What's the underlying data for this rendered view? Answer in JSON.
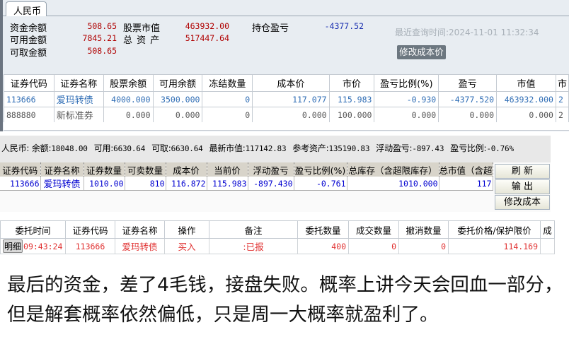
{
  "panel1": {
    "tab": "人民币",
    "summary": [
      {
        "label": "资金余额",
        "value": "508.65"
      },
      {
        "label": "可用金额",
        "value": "7845.21"
      },
      {
        "label": "可取金额",
        "value": "508.65"
      },
      {
        "label": "股票市值",
        "value": "463932.00"
      },
      {
        "label": "总 资 产",
        "value": "517447.64"
      },
      {
        "label": "持仓盈亏",
        "value": "-4377.52"
      }
    ],
    "query_time": "最近查询时间:2024-11-01 11:32:34",
    "modify_cost_button": "修改成本价",
    "columns": [
      "证券代码",
      "证券名称",
      "股票余额",
      "可用余额",
      "冻结数量",
      "成本价",
      "市价",
      "盈亏比例(%)",
      "盈亏",
      "市值",
      "市"
    ],
    "rows": [
      [
        "113666",
        "爱玛转债",
        "4000.000",
        "3500.000",
        "0",
        "117.077",
        "115.983",
        "-0.930",
        "-4377.520",
        "463932.000",
        "2"
      ],
      [
        "888880",
        "新标准券",
        "0.000",
        "0.000",
        "0",
        "0.000",
        "100.000",
        "0.000",
        "0.000",
        "0.000",
        "2"
      ]
    ]
  },
  "panel2": {
    "info": [
      {
        "label": "人民币: 余额:",
        "value": "18048.00"
      },
      {
        "label": "可用:",
        "value": "6630.64"
      },
      {
        "label": "可取:",
        "value": "6630.64"
      },
      {
        "label": "最新市值:",
        "value": "117142.83"
      },
      {
        "label": "参考资产:",
        "value": "135190.83"
      },
      {
        "label": "浮动盈亏:",
        "value": "-897.43"
      },
      {
        "label": "盈亏比例:",
        "value": "-0.76%"
      }
    ],
    "columns": [
      "证券代码",
      "证券名称",
      "证券数量",
      "可卖数量",
      "成本价",
      "当前价",
      "浮动盈亏",
      "盈亏比例(%)",
      "总库存（含超限库存）",
      "总市值（含超"
    ],
    "rows": [
      [
        "113666",
        "爱玛转债",
        "1010.00",
        "810",
        "116.872",
        "115.983",
        "-897.430",
        "-0.761",
        "1010.000",
        "117"
      ]
    ],
    "buttons": [
      "刷 新",
      "输 出",
      "修改成本"
    ]
  },
  "panel3": {
    "columns": [
      "委托时间",
      "证券代码",
      "证券名称",
      "操作",
      "备注",
      "委托数量",
      "成交数量",
      "撤消数量",
      "委托价格/保护限价",
      "成"
    ],
    "detail_button": "明细",
    "rows": [
      [
        "09:43:24",
        "113666",
        "爱玛转债",
        "买入",
        ":已报",
        "400",
        "0",
        "0",
        "114.169",
        ""
      ]
    ]
  },
  "caption": "最后的资金，差了4毛钱，接盘失败。概率上讲今天会回血一部分，但是解套概率依然偏低，只是周一大概率就盈利了。"
}
